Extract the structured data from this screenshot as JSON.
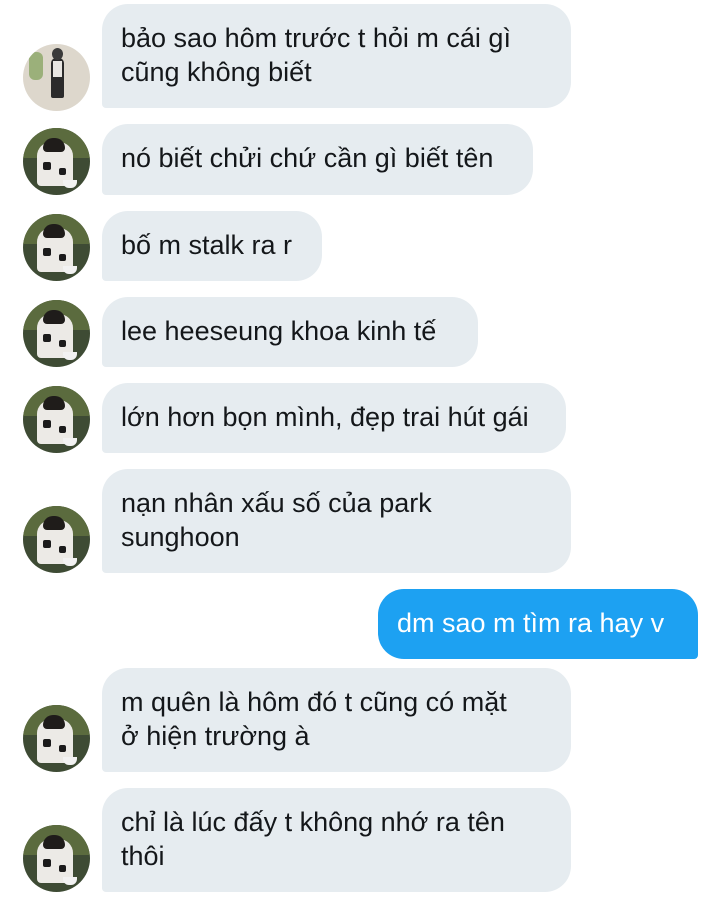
{
  "conversation": {
    "messages": [
      {
        "direction": "incoming",
        "lines": [
          "bảo sao hôm trước t hỏi m cái gì",
          "cũng không biết"
        ],
        "avatar": "user-photo-standing"
      },
      {
        "direction": "incoming",
        "lines": [
          "nó biết chửi chứ cần gì biết tên"
        ],
        "avatar": "user-photo-sitting"
      },
      {
        "direction": "incoming",
        "lines": [
          "bố m stalk ra r"
        ],
        "avatar": "user-photo-sitting"
      },
      {
        "direction": "incoming",
        "lines": [
          "lee heeseung khoa kinh tế"
        ],
        "avatar": "user-photo-sitting"
      },
      {
        "direction": "incoming",
        "lines": [
          "lớn hơn bọn mình, đẹp trai hút gái"
        ],
        "avatar": "user-photo-sitting"
      },
      {
        "direction": "incoming",
        "lines": [
          "nạn nhân xấu số của park",
          "sunghoon"
        ],
        "avatar": "user-photo-sitting"
      },
      {
        "direction": "outgoing",
        "lines": [
          "dm sao m tìm ra hay v"
        ]
      },
      {
        "direction": "incoming",
        "lines": [
          "m quên là hôm đó t cũng có mặt",
          "ở hiện trường à"
        ],
        "avatar": "user-photo-sitting"
      },
      {
        "direction": "incoming",
        "lines": [
          "chỉ là lúc đấy t không nhớ ra tên",
          "thôi"
        ],
        "avatar": "user-photo-sitting"
      }
    ]
  },
  "colors": {
    "incoming_bubble": "#e6ecf0",
    "outgoing_bubble": "#1da1f2",
    "text_dark": "#14171a",
    "text_light": "#ffffff"
  }
}
